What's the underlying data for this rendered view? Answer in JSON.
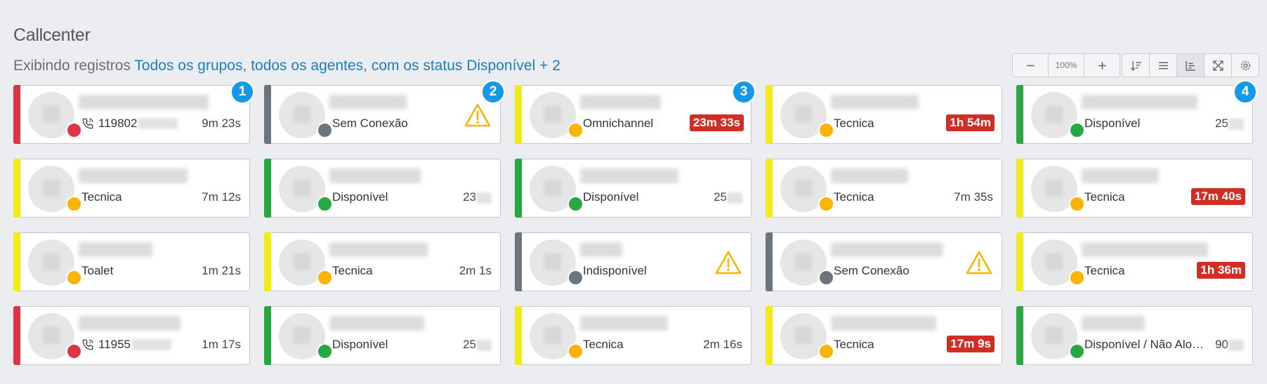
{
  "header": {
    "title": "Callcenter",
    "prefix": "Exibindo registros",
    "groups_link": "Todos os grupos",
    "sep1": ",",
    "agents_link": "todos os agentes",
    "sep2": ",",
    "status_link": "com os status Disponível + 2"
  },
  "toolbar": {
    "zoom_out": "minus-icon",
    "zoom_level": "100%",
    "zoom_in": "plus-icon",
    "views": [
      "sort-icon",
      "list-icon",
      "chart-icon",
      "fullscreen-icon",
      "settings-icon"
    ]
  },
  "colors": {
    "red": "#dc3545",
    "gray": "#6c757d",
    "yellow": "#f2ea1a",
    "green": "#28a745",
    "amber": "#fbb400",
    "alert": "#d02e24",
    "link": "#1a7fc1",
    "badge": "#1599e6"
  },
  "cards": [
    {
      "stripe": "red",
      "dot": "red",
      "kind": "phone",
      "status": "119802",
      "timer": "9m 23s",
      "alert": false,
      "badge": "1"
    },
    {
      "stripe": "gray",
      "dot": "gray",
      "kind": "warn",
      "status": "Sem Conexão",
      "timer": "",
      "alert": false,
      "badge": "2"
    },
    {
      "stripe": "yellow",
      "dot": "amber",
      "kind": "text",
      "status": "Omnichannel",
      "timer": "23m 33s",
      "alert": true,
      "badge": "3"
    },
    {
      "stripe": "yellow",
      "dot": "amber",
      "kind": "text",
      "status": "Tecnica",
      "timer": "1h 54m",
      "alert": true,
      "badge": ""
    },
    {
      "stripe": "green",
      "dot": "green",
      "kind": "text",
      "status": "Disponível",
      "timer": "25",
      "alert": false,
      "badge": "4",
      "partial": true
    },
    {
      "stripe": "yellow",
      "dot": "amber",
      "kind": "text",
      "status": "Tecnica",
      "timer": "7m 12s",
      "alert": false,
      "badge": ""
    },
    {
      "stripe": "green",
      "dot": "green",
      "kind": "text",
      "status": "Disponível",
      "timer": "23",
      "alert": false,
      "badge": "",
      "partial": true
    },
    {
      "stripe": "green",
      "dot": "green",
      "kind": "text",
      "status": "Disponível",
      "timer": "25",
      "alert": false,
      "badge": "",
      "partial": true
    },
    {
      "stripe": "yellow",
      "dot": "amber",
      "kind": "text",
      "status": "Tecnica",
      "timer": "7m 35s",
      "alert": false,
      "badge": ""
    },
    {
      "stripe": "yellow",
      "dot": "amber",
      "kind": "text",
      "status": "Tecnica",
      "timer": "17m 40s",
      "alert": true,
      "badge": ""
    },
    {
      "stripe": "yellow",
      "dot": "amber",
      "kind": "text",
      "status": "Toalet",
      "timer": "1m 21s",
      "alert": false,
      "badge": ""
    },
    {
      "stripe": "yellow",
      "dot": "amber",
      "kind": "text",
      "status": "Tecnica",
      "timer": "2m 1s",
      "alert": false,
      "badge": ""
    },
    {
      "stripe": "gray",
      "dot": "gray",
      "kind": "warn",
      "status": "Indisponível",
      "timer": "",
      "alert": false,
      "badge": ""
    },
    {
      "stripe": "gray",
      "dot": "gray",
      "kind": "warn",
      "status": "Sem Conexão",
      "timer": "",
      "alert": false,
      "badge": ""
    },
    {
      "stripe": "yellow",
      "dot": "amber",
      "kind": "text",
      "status": "Tecnica",
      "timer": "1h 36m",
      "alert": true,
      "badge": ""
    },
    {
      "stripe": "red",
      "dot": "red",
      "kind": "phone",
      "status": "11955",
      "timer": "1m 17s",
      "alert": false,
      "badge": ""
    },
    {
      "stripe": "green",
      "dot": "green",
      "kind": "text",
      "status": "Disponível",
      "timer": "25",
      "alert": false,
      "badge": "",
      "partial": true
    },
    {
      "stripe": "yellow",
      "dot": "amber",
      "kind": "text",
      "status": "Tecnica",
      "timer": "2m 16s",
      "alert": false,
      "badge": ""
    },
    {
      "stripe": "yellow",
      "dot": "amber",
      "kind": "text",
      "status": "Tecnica",
      "timer": "17m 9s",
      "alert": true,
      "badge": ""
    },
    {
      "stripe": "green",
      "dot": "green",
      "kind": "text",
      "status": "Disponível / Não Alocado",
      "timer": "90",
      "alert": false,
      "badge": "",
      "partial": true
    }
  ]
}
